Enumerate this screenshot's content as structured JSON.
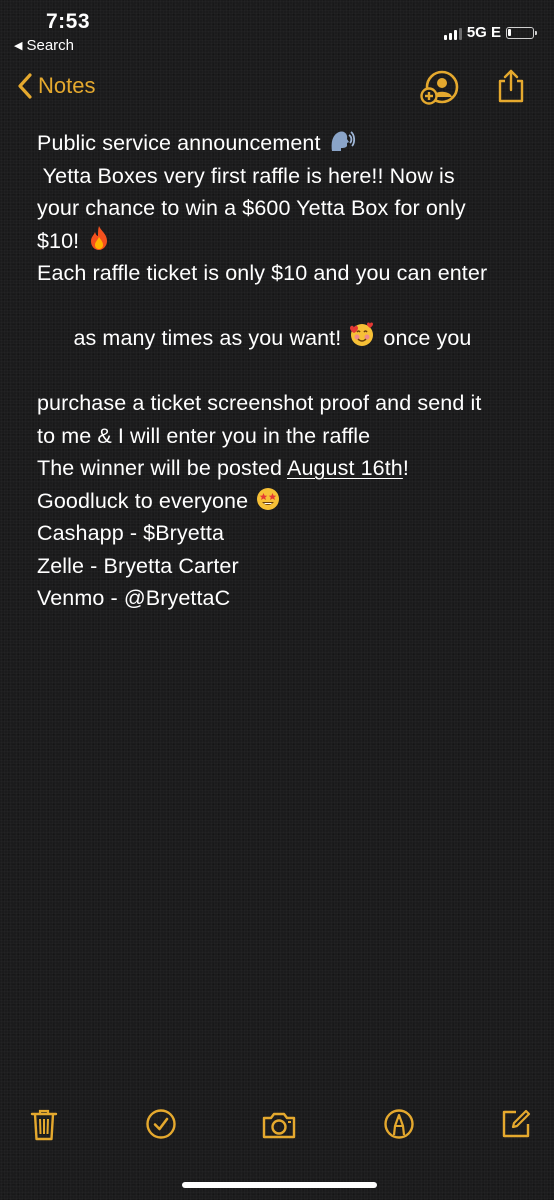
{
  "status_bar": {
    "time": "7:53",
    "back_label": "Search",
    "network": "5G E"
  },
  "nav": {
    "back_label": "Notes",
    "icons": [
      "add-people-icon",
      "share-icon"
    ]
  },
  "note": {
    "lines": [
      {
        "text": "Public service announcement",
        "emoji": "speaking-head-icon"
      },
      {
        "text": " Yetta Boxes very first raffle is here!! Now is"
      },
      {
        "text": "your chance to win a $600 Yetta Box for only"
      },
      {
        "text": "$10!",
        "emoji": "fire-icon"
      },
      {
        "text": "Each raffle ticket is only $10 and you can enter"
      },
      {
        "text": "as many times as you want!",
        "emoji": "smiling-face-with-hearts-icon",
        "after": " once you"
      },
      {
        "text": "purchase a ticket screenshot proof and send it"
      },
      {
        "text": "to me & I will enter you in the raffle"
      },
      {
        "text": "The winner will be posted ",
        "link": "August 16th",
        "after": "!"
      },
      {
        "text": "Goodluck to everyone",
        "emoji": "star-struck-icon"
      },
      {
        "text": "Cashapp - $Bryetta"
      },
      {
        "text": "Zelle - Bryetta Carter"
      },
      {
        "text": "Venmo - @BryettaC"
      }
    ]
  },
  "toolbar": {
    "icons": [
      "trash-icon",
      "checklist-icon",
      "camera-icon",
      "markup-icon",
      "compose-icon"
    ]
  },
  "colors": {
    "accent": "#e5a92e",
    "text": "#ffffff",
    "background": "#1b1b1c"
  }
}
